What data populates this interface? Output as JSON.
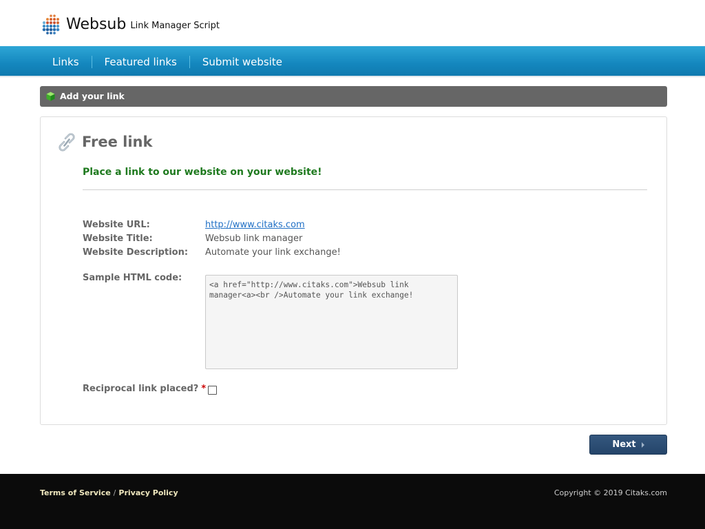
{
  "header": {
    "logo_name": "Websub",
    "logo_tagline": "Link Manager Script",
    "logo_icon": "dot-grid-logo-icon"
  },
  "nav": {
    "items": [
      {
        "label": "Links"
      },
      {
        "label": "Featured links"
      },
      {
        "label": "Submit website"
      }
    ]
  },
  "section": {
    "title": "Add your link",
    "icon": "green-cube-icon"
  },
  "panel": {
    "title": "Free link",
    "title_icon": "chain-link-icon",
    "subtitle": "Place a link to our website on your website!",
    "fields": {
      "url_label": "Website URL:",
      "url_value": "http://www.citaks.com",
      "title_label": "Website Title:",
      "title_value": "Websub link manager",
      "desc_label": "Website Description:",
      "desc_value": "Automate your link exchange!",
      "code_label": "Sample HTML code:",
      "code_value": "<a href=\"http://www.citaks.com\">Websub link manager<a><br />Automate your link exchange!",
      "reciprocal_label": "Reciprocal link placed?",
      "required_mark": "*"
    }
  },
  "actions": {
    "next_label": "Next"
  },
  "footer": {
    "terms": "Terms of Service",
    "separator": "/",
    "privacy": "Privacy Policy",
    "copyright": "Copyright © 2019 Citaks.com"
  },
  "colors": {
    "nav_blue": "#1487be",
    "section_gray": "#666666",
    "subtitle_green": "#1f7a1f",
    "button_navy": "#2b4b72",
    "footer_black": "#0b0b0b"
  }
}
